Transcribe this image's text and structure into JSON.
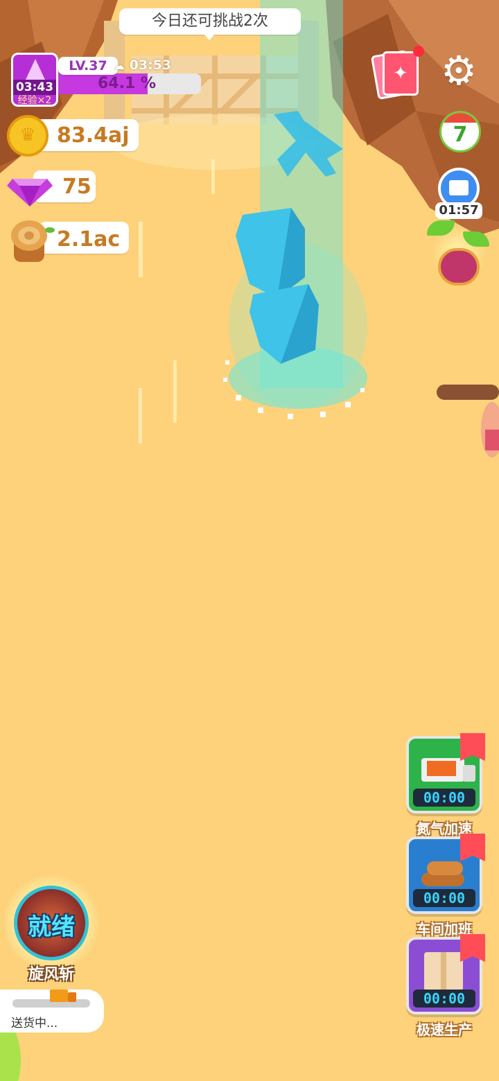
{
  "challenge": {
    "text": "今日还可挑战2次"
  },
  "player": {
    "level": "LV.37",
    "badge_timer": "03:43",
    "exp_bonus": "经验×2",
    "weather_timer": "03:53",
    "progress_text": "64.1 %",
    "progress_value": 0.641
  },
  "resources": {
    "coins": "83.4aj",
    "gems": "75",
    "wood": "2.1ac"
  },
  "right_icons": {
    "calendar_day": "7",
    "shop_timer": "01:57"
  },
  "boosts": [
    {
      "timer": "00:00",
      "label": "氮气加速"
    },
    {
      "timer": "00:00",
      "label": "车间加班"
    },
    {
      "timer": "00:00",
      "label": "极速生产"
    }
  ],
  "skill": {
    "state": "就绪",
    "name": "旋风斩"
  },
  "delivery": {
    "status": "送货中..."
  },
  "colors": {
    "sand": "#fdd27b",
    "rock": "#b96a3a",
    "crystal": "#3fd4f0",
    "exp_bar": "#c638e0",
    "boost_green": "#2db34a",
    "boost_blue": "#2a7ecf",
    "boost_purple": "#8b4dd4"
  }
}
